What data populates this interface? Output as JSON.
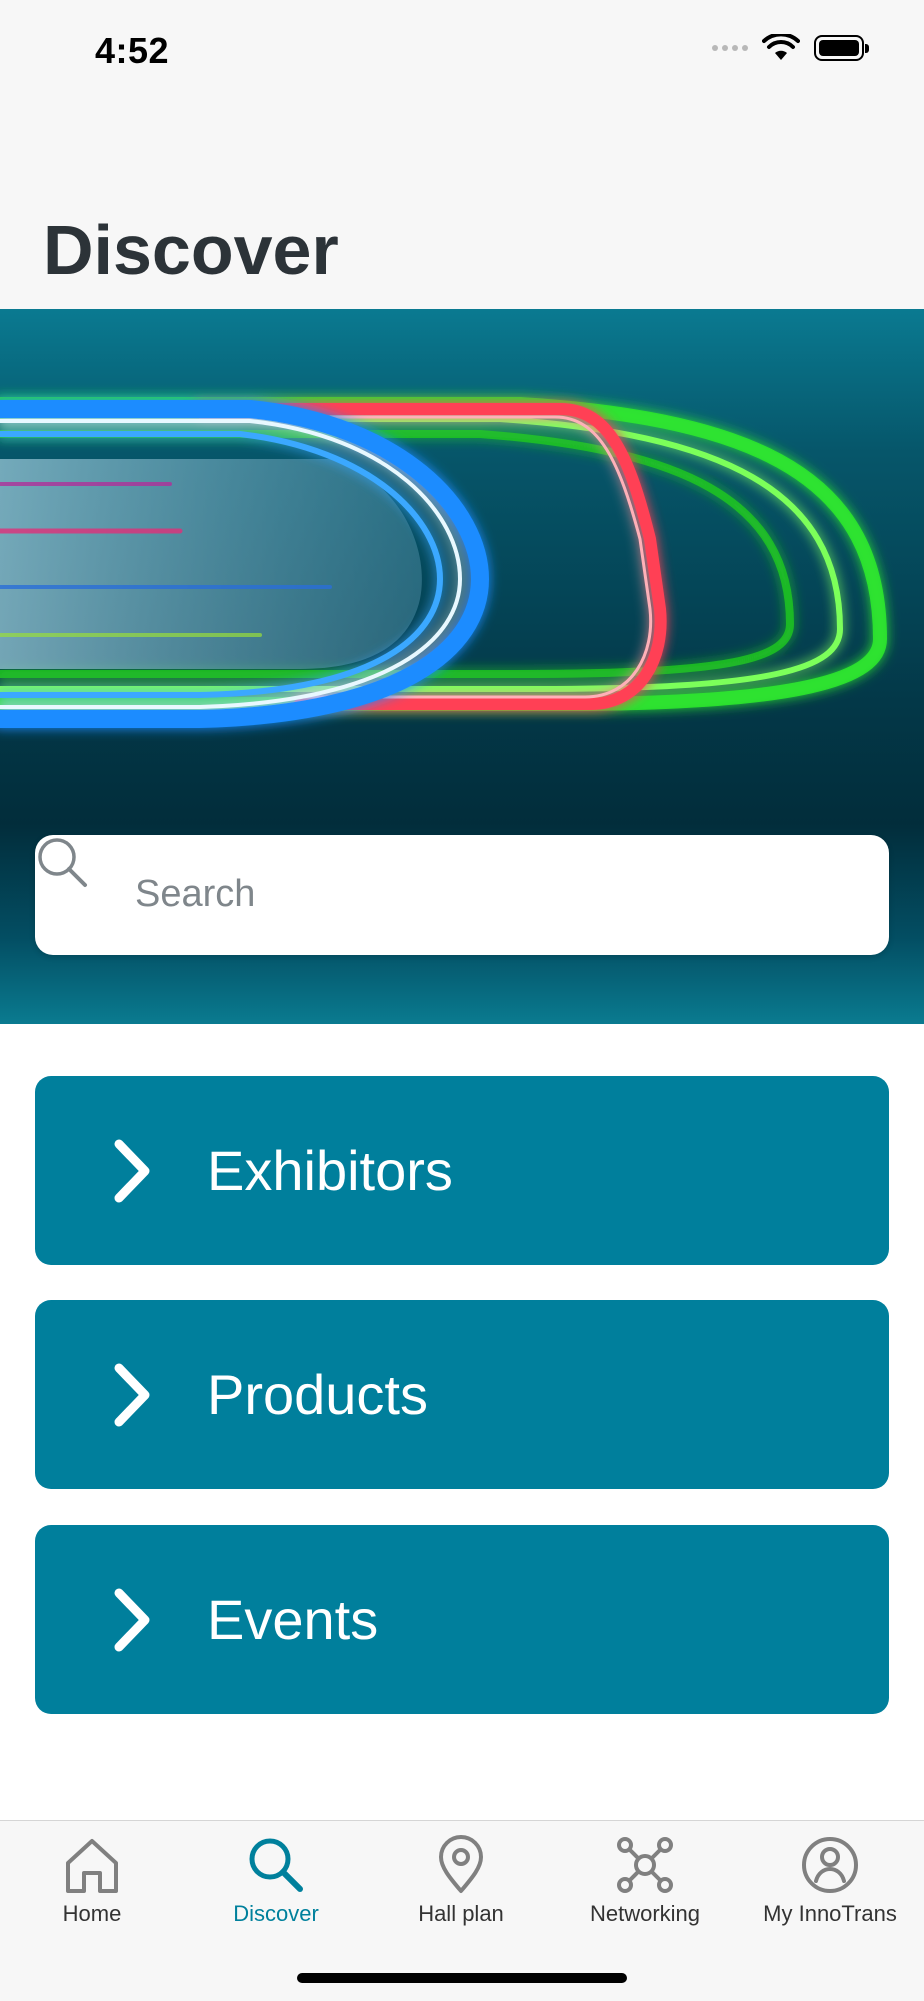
{
  "status_bar": {
    "time": "4:52"
  },
  "header": {
    "title": "Discover"
  },
  "search": {
    "placeholder": "Search"
  },
  "menu": {
    "items": [
      {
        "label": "Exhibitors"
      },
      {
        "label": "Products"
      },
      {
        "label": "Events"
      }
    ]
  },
  "tabbar": {
    "active": "Discover",
    "tabs": [
      {
        "label": "Home",
        "icon": "house-icon"
      },
      {
        "label": "Discover",
        "icon": "search-icon"
      },
      {
        "label": "Hall plan",
        "icon": "map-pin-icon"
      },
      {
        "label": "Networking",
        "icon": "network-icon"
      },
      {
        "label": "My InnoTrans",
        "icon": "user-circle-icon"
      }
    ]
  },
  "colors": {
    "accent": "#007f9c",
    "header_bg": "#f7f7f7",
    "title_text": "#2c3338",
    "hero_dark": "#022d3b"
  }
}
